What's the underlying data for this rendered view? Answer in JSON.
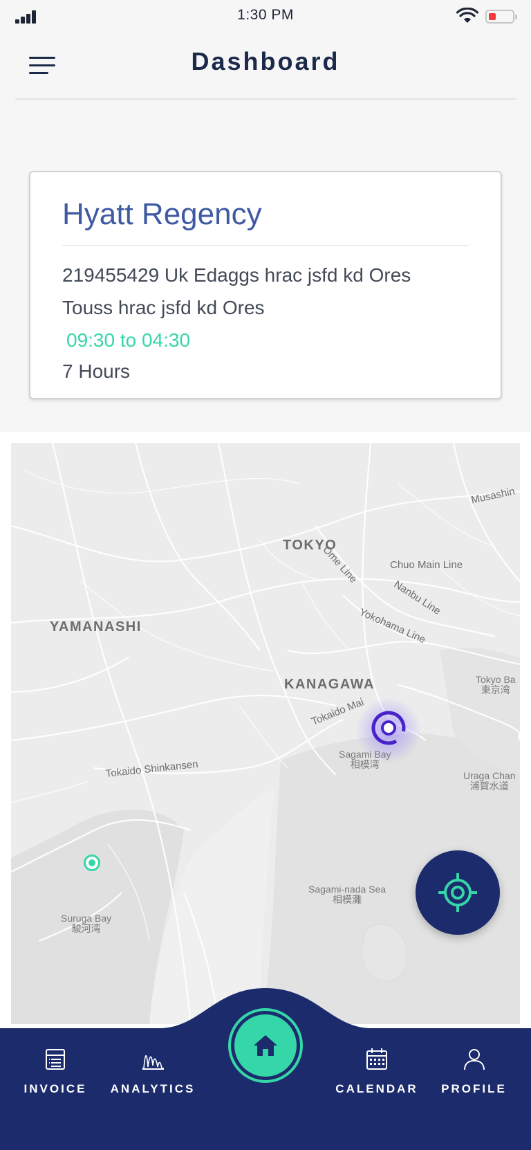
{
  "status_bar": {
    "time": "1:30 PM"
  },
  "header": {
    "title": "Dashboard",
    "menu_icon": "hamburger-menu-icon"
  },
  "card": {
    "title": "Hyatt Regency",
    "address_line1": "219455429 Uk Edaggs hrac jsfd kd Ores",
    "address_line2": "Touss hrac jsfd kd Ores",
    "time_range": "09:30 to 04:30",
    "duration": "7 Hours"
  },
  "map": {
    "labels": {
      "tokyo": "TOKYO",
      "yamanashi": "YAMANASHI",
      "kanagawa": "KANAGAWA",
      "musashino": "Musashin",
      "ome_line": "Ome Line",
      "chuo_line": "Chuo Main Line",
      "nanbu_line": "Nanbu Line",
      "yokohama_line": "Yokohama Line",
      "tokaido_main": "Tokaido Mai",
      "tokaido_shinkansen": "Tokaido Shinkansen",
      "tokyo_bay_en": "Tokyo Ba",
      "tokyo_bay_jp": "東京湾",
      "sagami_bay_en": "Sagami Bay",
      "sagami_bay_jp": "相模湾",
      "uraga_en": "Uraga Chan",
      "uraga_jp": "浦賀水道",
      "sagami_nada_en": "Sagami-nada Sea",
      "sagami_nada_jp": "相模灘",
      "suruga_en": "Suruga Bay",
      "suruga_jp": "駿河湾"
    }
  },
  "locate_button": {
    "icon": "crosshair-icon"
  },
  "nav": {
    "items": [
      {
        "label": "INVOICE",
        "icon": "invoice-icon"
      },
      {
        "label": "ANALYTICS",
        "icon": "analytics-icon"
      },
      {
        "label": "CALENDAR",
        "icon": "calendar-icon"
      },
      {
        "label": "PROFILE",
        "icon": "profile-icon"
      }
    ],
    "home_icon": "home-icon"
  },
  "colors": {
    "navy": "#1b2b6b",
    "accent_green": "#35d7a8",
    "title_blue": "#3f5aa3",
    "pin_purple": "#4a22c9",
    "battery_red": "#f23b3b"
  }
}
